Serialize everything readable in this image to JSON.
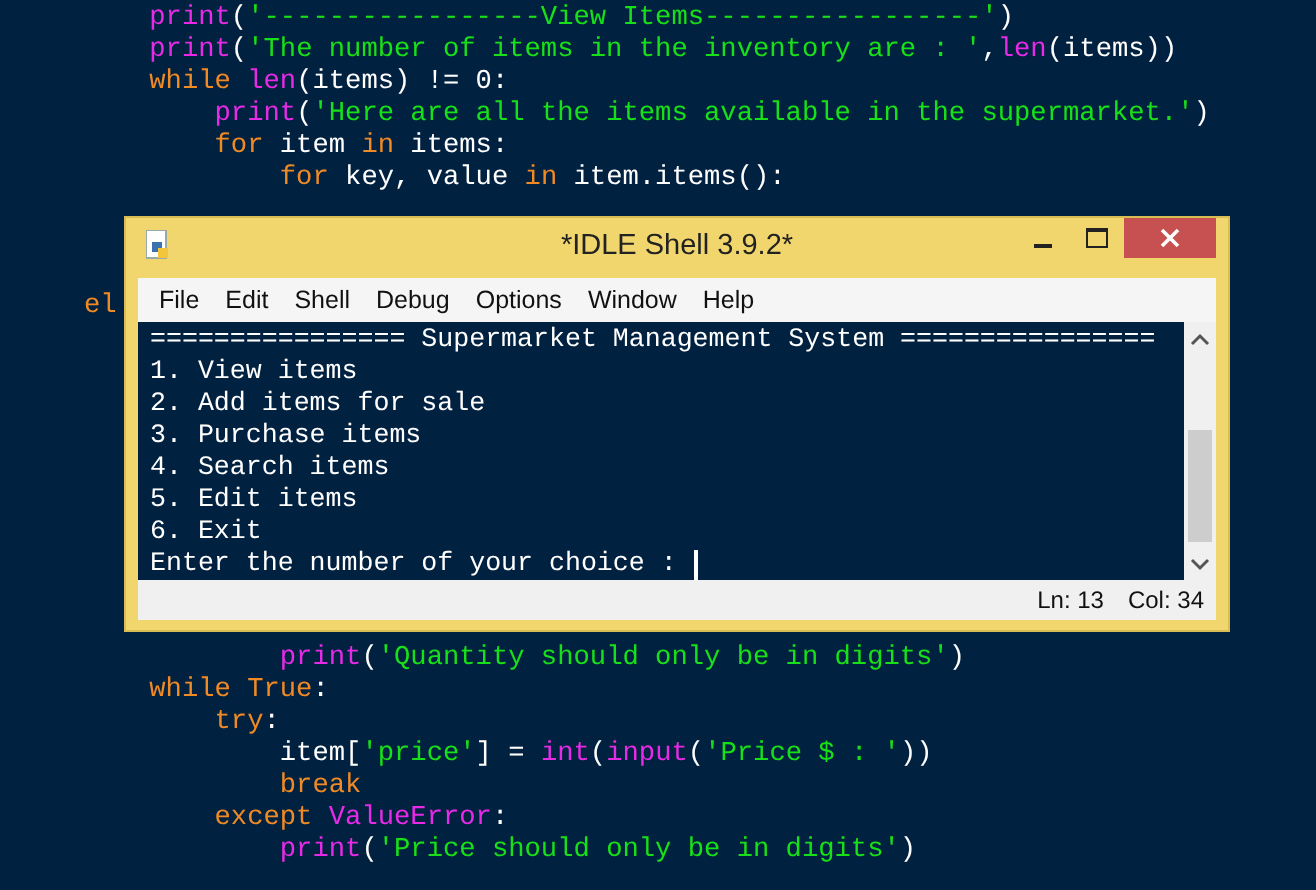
{
  "editor": {
    "code_top": [
      [
        {
          "kind": "builtin",
          "text": "    print"
        },
        {
          "kind": "plain",
          "text": "("
        },
        {
          "kind": "string",
          "text": "'-----------------View Items-----------------'"
        },
        {
          "kind": "plain",
          "text": ")"
        }
      ],
      [
        {
          "kind": "builtin",
          "text": "    print"
        },
        {
          "kind": "plain",
          "text": "("
        },
        {
          "kind": "string",
          "text": "'The number of items in the inventory are : '"
        },
        {
          "kind": "plain",
          "text": ","
        },
        {
          "kind": "builtin",
          "text": "len"
        },
        {
          "kind": "plain",
          "text": "(items))"
        }
      ],
      [
        {
          "kind": "keyword",
          "text": "    while"
        },
        {
          "kind": "builtin",
          "text": " len"
        },
        {
          "kind": "plain",
          "text": "(items) != 0:"
        }
      ],
      [
        {
          "kind": "builtin",
          "text": "        print"
        },
        {
          "kind": "plain",
          "text": "("
        },
        {
          "kind": "string",
          "text": "'Here are all the items available in the supermarket.'"
        },
        {
          "kind": "plain",
          "text": ")"
        }
      ],
      [
        {
          "kind": "keyword",
          "text": "        for"
        },
        {
          "kind": "plain",
          "text": " item "
        },
        {
          "kind": "keyword",
          "text": "in"
        },
        {
          "kind": "plain",
          "text": " items:"
        }
      ],
      [
        {
          "kind": "keyword",
          "text": "            for"
        },
        {
          "kind": "plain",
          "text": " key, value "
        },
        {
          "kind": "keyword",
          "text": "in"
        },
        {
          "kind": "plain",
          "text": " item.items():"
        }
      ]
    ],
    "code_middle": [
      [
        {
          "kind": "keyword",
          "text": "el"
        }
      ]
    ],
    "code_bottom": [
      [
        {
          "kind": "builtin",
          "text": "            print"
        },
        {
          "kind": "plain",
          "text": "("
        },
        {
          "kind": "string",
          "text": "'Quantity should only be in digits'"
        },
        {
          "kind": "plain",
          "text": ")"
        }
      ],
      [
        {
          "kind": "keyword",
          "text": "    while"
        },
        {
          "kind": "keyword",
          "text": " True"
        },
        {
          "kind": "plain",
          "text": ":"
        }
      ],
      [
        {
          "kind": "keyword",
          "text": "        try"
        },
        {
          "kind": "plain",
          "text": ":"
        }
      ],
      [
        {
          "kind": "plain",
          "text": "            item["
        },
        {
          "kind": "string",
          "text": "'price'"
        },
        {
          "kind": "plain",
          "text": "] = "
        },
        {
          "kind": "builtin",
          "text": "int"
        },
        {
          "kind": "plain",
          "text": "("
        },
        {
          "kind": "builtin",
          "text": "input"
        },
        {
          "kind": "plain",
          "text": "("
        },
        {
          "kind": "string",
          "text": "'Price $ : '"
        },
        {
          "kind": "plain",
          "text": "))"
        }
      ],
      [
        {
          "kind": "keyword",
          "text": "            break"
        }
      ],
      [
        {
          "kind": "keyword",
          "text": "        except"
        },
        {
          "kind": "builtin",
          "text": " ValueError"
        },
        {
          "kind": "plain",
          "text": ":"
        }
      ],
      [
        {
          "kind": "builtin",
          "text": "            print"
        },
        {
          "kind": "plain",
          "text": "("
        },
        {
          "kind": "string",
          "text": "'Price should only be in digits'"
        },
        {
          "kind": "plain",
          "text": ")"
        }
      ]
    ]
  },
  "shell_window": {
    "title": "*IDLE Shell 3.9.2*",
    "menu": [
      "File",
      "Edit",
      "Shell",
      "Debug",
      "Options",
      "Window",
      "Help"
    ],
    "output_lines": [
      "================ Supermarket Management System ================",
      "1. View items",
      "2. Add items for sale",
      "3. Purchase items",
      "4. Search items",
      "5. Edit items",
      "6. Exit"
    ],
    "prompt": "Enter the number of your choice : ",
    "status": {
      "line": "Ln: 13",
      "column": "Col: 34"
    }
  }
}
